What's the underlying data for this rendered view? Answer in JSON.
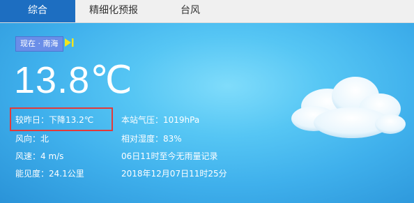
{
  "tabs": [
    {
      "label": "综合",
      "active": true
    },
    {
      "label": "精细化预报",
      "active": false
    },
    {
      "label": "台风",
      "active": false
    }
  ],
  "location_badge": "现在 · 南海",
  "temperature": "13.8℃",
  "details": {
    "change": "较昨日：下降13.2℃",
    "pressure": "本站气压：1019hPa",
    "wind_dir": "风向：北",
    "humidity": "相对湿度：83%",
    "wind_speed": "风速：4 m/s",
    "rain": "06日11时至今无雨量记录",
    "visibility": "能见度：24.1公里",
    "updated": "2018年12月07日11时25分"
  },
  "colors": {
    "tab_active": "#1d6ec1",
    "highlight": "#e23a3a",
    "play_icon": "#f2e51e"
  },
  "icons": [
    "play-skip-icon",
    "cloud-icon"
  ]
}
